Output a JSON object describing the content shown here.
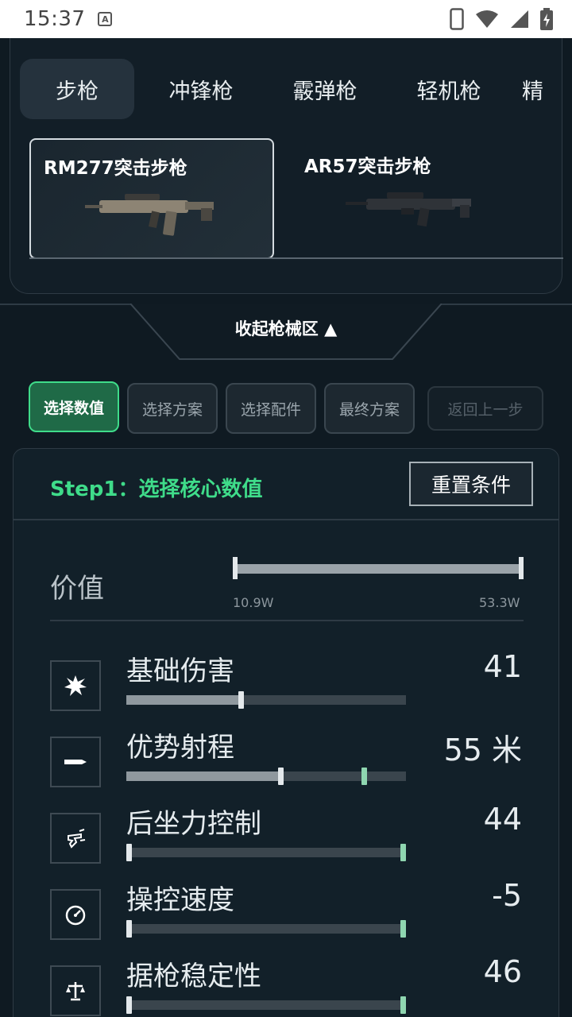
{
  "status_bar": {
    "time": "15:37",
    "a_badge": "A"
  },
  "categories": [
    {
      "label": "步枪",
      "active": true
    },
    {
      "label": "冲锋枪",
      "active": false
    },
    {
      "label": "霰弹枪",
      "active": false
    },
    {
      "label": "轻机枪",
      "active": false
    },
    {
      "label": "精",
      "active": false
    }
  ],
  "guns": [
    {
      "name": "RM277突击步枪",
      "selected": true
    },
    {
      "name": "AR57突击步枪",
      "selected": false
    }
  ],
  "collapse_label": "收起枪械区 ▲",
  "steps": [
    {
      "label": "选择数值",
      "state": "active"
    },
    {
      "label": "选择方案",
      "state": "normal"
    },
    {
      "label": "选择配件",
      "state": "normal"
    },
    {
      "label": "最终方案",
      "state": "normal"
    },
    {
      "label": "返回上一步",
      "state": "disabled"
    }
  ],
  "core": {
    "title": "Step1：选择核心数值",
    "reset_label": "重置条件",
    "price": {
      "label": "价值",
      "min": "10.9W",
      "max": "53.3W"
    },
    "stats": [
      {
        "name": "基础伤害",
        "value": "41",
        "icon": "explosion-icon",
        "fill": 0.41,
        "knobs": [
          0.41
        ]
      },
      {
        "name": "优势射程",
        "value": "55 米",
        "icon": "bullet-icon",
        "fill": 0.55,
        "knobs": [
          0.55,
          0.85
        ]
      },
      {
        "name": "后坐力控制",
        "value": "44",
        "icon": "recoil-hand-icon",
        "fill": 0,
        "knobs": [
          0,
          1
        ]
      },
      {
        "name": "操控速度",
        "value": "-5",
        "icon": "speedometer-icon",
        "fill": 0,
        "knobs": [
          0,
          1
        ]
      },
      {
        "name": "据枪稳定性",
        "value": "46",
        "icon": "balance-icon",
        "fill": 0,
        "knobs": [
          0,
          1
        ]
      }
    ]
  },
  "colors": {
    "accent": "#3fdc8a",
    "background": "#0f1a22"
  }
}
